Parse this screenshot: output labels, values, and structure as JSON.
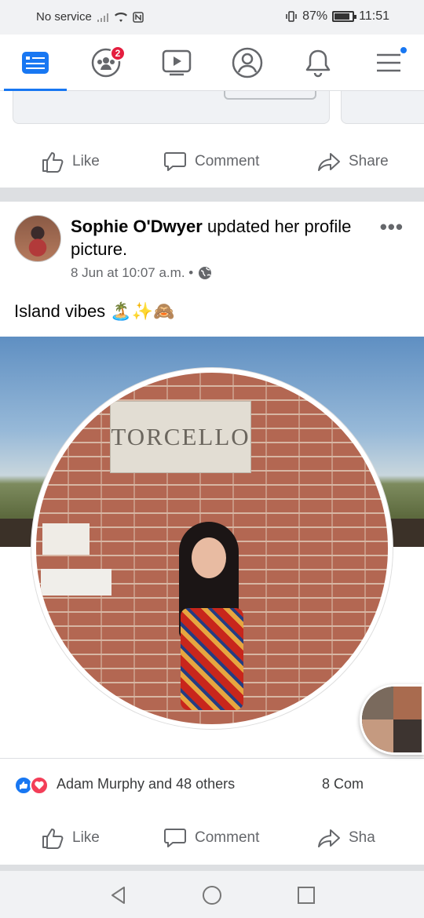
{
  "status_bar": {
    "network": "No service",
    "battery_percent": "87%",
    "battery_level": 0.87,
    "time": "11:51"
  },
  "nav": {
    "tabs": [
      {
        "icon": "news-feed-icon",
        "active": true
      },
      {
        "icon": "groups-icon",
        "badge": "2"
      },
      {
        "icon": "watch-icon"
      },
      {
        "icon": "profile-icon"
      },
      {
        "icon": "notifications-icon"
      },
      {
        "icon": "menu-icon",
        "dot": true
      }
    ]
  },
  "prev_post_actions": {
    "like": "Like",
    "comment": "Comment",
    "share": "Share"
  },
  "post": {
    "author": "Sophie O'Dwyer",
    "action": " updated her profile picture.",
    "timestamp": "8 Jun at 10:07 a.m. •",
    "privacy_icon": "globe-icon",
    "more": "•••",
    "caption": "Island vibes 🏝️✨🙈",
    "photo_sign": "TORCELLO",
    "reactions_text": "Adam Murphy and 48 others",
    "comments_text": "8 Com",
    "actions": {
      "like": "Like",
      "comment": "Comment",
      "share": "Sha"
    }
  },
  "colors": {
    "brand": "#1877f2",
    "badge": "#e41e3f",
    "love": "#f33e58",
    "muted": "#65676b"
  }
}
